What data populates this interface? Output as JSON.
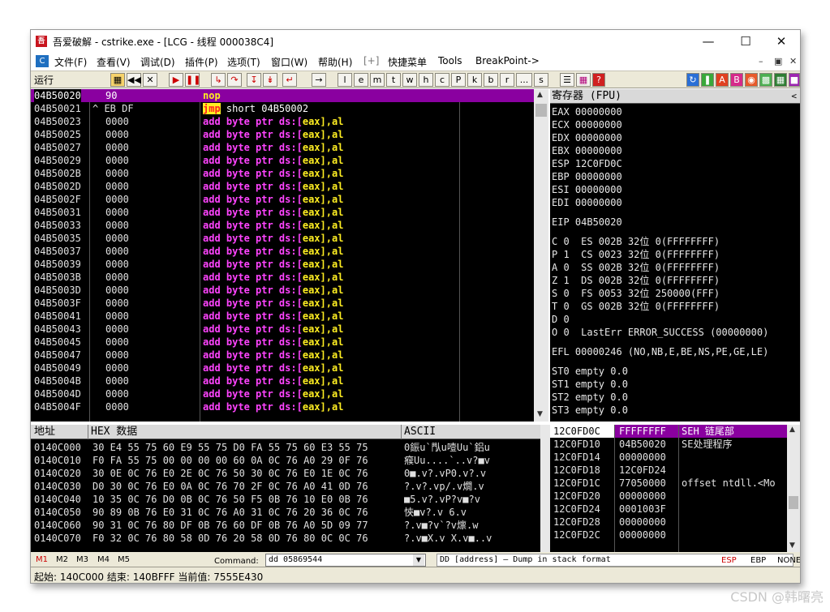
{
  "window": {
    "title": "吾爱破解 - cstrike.exe - [LCG - 线程 000038C4]",
    "app_icon": "吾爱"
  },
  "menu": {
    "items": [
      "文件(F)",
      "查看(V)",
      "调试(D)",
      "插件(P)",
      "选项(T)",
      "窗口(W)",
      "帮助(H)",
      "[+]",
      "快捷菜单",
      "Tools",
      "BreakPoint->"
    ]
  },
  "toolbar": {
    "status": "运行",
    "letters": [
      "l",
      "e",
      "m",
      "t",
      "w",
      "h",
      "c",
      "P",
      "k",
      "b",
      "r",
      "...",
      "s"
    ]
  },
  "disasm": {
    "rows": [
      {
        "addr": "04B50020",
        "hex": "90",
        "asm": "nop",
        "sel": true
      },
      {
        "addr": "04B50021",
        "hex": "^ EB DF",
        "asm": "jmp",
        "arg": " short 04B50002",
        "jmp": true
      },
      {
        "addr": "04B50023",
        "hex": "0000",
        "asm": "add"
      },
      {
        "addr": "04B50025",
        "hex": "0000",
        "asm": "add"
      },
      {
        "addr": "04B50027",
        "hex": "0000",
        "asm": "add"
      },
      {
        "addr": "04B50029",
        "hex": "0000",
        "asm": "add"
      },
      {
        "addr": "04B5002B",
        "hex": "0000",
        "asm": "add"
      },
      {
        "addr": "04B5002D",
        "hex": "0000",
        "asm": "add"
      },
      {
        "addr": "04B5002F",
        "hex": "0000",
        "asm": "add"
      },
      {
        "addr": "04B50031",
        "hex": "0000",
        "asm": "add"
      },
      {
        "addr": "04B50033",
        "hex": "0000",
        "asm": "add"
      },
      {
        "addr": "04B50035",
        "hex": "0000",
        "asm": "add"
      },
      {
        "addr": "04B50037",
        "hex": "0000",
        "asm": "add"
      },
      {
        "addr": "04B50039",
        "hex": "0000",
        "asm": "add"
      },
      {
        "addr": "04B5003B",
        "hex": "0000",
        "asm": "add"
      },
      {
        "addr": "04B5003D",
        "hex": "0000",
        "asm": "add"
      },
      {
        "addr": "04B5003F",
        "hex": "0000",
        "asm": "add"
      },
      {
        "addr": "04B50041",
        "hex": "0000",
        "asm": "add"
      },
      {
        "addr": "04B50043",
        "hex": "0000",
        "asm": "add"
      },
      {
        "addr": "04B50045",
        "hex": "0000",
        "asm": "add"
      },
      {
        "addr": "04B50047",
        "hex": "0000",
        "asm": "add"
      },
      {
        "addr": "04B50049",
        "hex": "0000",
        "asm": "add"
      },
      {
        "addr": "04B5004B",
        "hex": "0000",
        "asm": "add"
      },
      {
        "addr": "04B5004D",
        "hex": "0000",
        "asm": "add"
      },
      {
        "addr": "04B5004F",
        "hex": "0000",
        "asm": "add"
      }
    ],
    "add_operand": " byte ptr ds:[eax],al"
  },
  "registers": {
    "header": "寄存器 (FPU)",
    "lines": [
      "EAX 00000000",
      "ECX 00000000",
      "EDX 00000000",
      "EBX 00000000",
      "ESP 12C0FD0C",
      "EBP 00000000",
      "ESI 00000000",
      "EDI 00000000",
      "",
      "EIP 04B50020",
      "",
      "C 0  ES 002B 32位 0(FFFFFFFF)",
      "P 1  CS 0023 32位 0(FFFFFFFF)",
      "A 0  SS 002B 32位 0(FFFFFFFF)",
      "Z 1  DS 002B 32位 0(FFFFFFFF)",
      "S 0  FS 0053 32位 250000(FFF)",
      "T 0  GS 002B 32位 0(FFFFFFFF)",
      "D 0",
      "O 0  LastErr ERROR_SUCCESS (00000000)",
      "",
      "EFL 00000246 (NO,NB,E,BE,NS,PE,GE,LE)",
      "",
      "ST0 empty 0.0",
      "ST1 empty 0.0",
      "ST2 empty 0.0",
      "ST3 empty 0.0"
    ]
  },
  "dump": {
    "h_addr": "地址",
    "h_hex": "HEX 数据",
    "h_ascii": "ASCII",
    "rows": [
      {
        "addr": "0140C000",
        "hex": "30 E4 55 75 60 E9 55 75 D0 FA 55 75 60 E3 55 75",
        "ascii": "0鋠u`閄u噎Uu`鋁u"
      },
      {
        "addr": "0140C010",
        "hex": "F0 FA 55 75 00 00 00 00 60 0A 0C 76 A0 29 0F 76",
        "ascii": "瘊Uu....`..v?■v"
      },
      {
        "addr": "0140C020",
        "hex": "30 0E 0C 76 E0 2E 0C 76 50 30 0C 76 E0 1E 0C 76",
        "ascii": "0■.v?.vP0.v?.v"
      },
      {
        "addr": "0140C030",
        "hex": "D0 30 0C 76 E0 0A 0C 76 70 2F 0C 76 A0 41 0D 76",
        "ascii": "?.v?.vp/.v燗.v"
      },
      {
        "addr": "0140C040",
        "hex": "10 35 0C 76 D0 0B 0C 76 50 F5 0B 76 10 E0 0B 76",
        "ascii": "■5.v?.vP?v■?v"
      },
      {
        "addr": "0140C050",
        "hex": "90 89 0B 76 E0 31 0C 76 A0 31 0C 76 20 36 0C 76",
        "ascii": "悏■v?.v 6.v"
      },
      {
        "addr": "0140C060",
        "hex": "90 31 0C 76 80 DF 0B 76 60 DF 0B 76 A0 5D 09 77",
        "ascii": "?.v■?v`?v燷.w"
      },
      {
        "addr": "0140C070",
        "hex": "F0 32 0C 76 80 58 0D 76 20 58 0D 76 80 0C 0C 76",
        "ascii": "?.v■X.v X.v■..v"
      }
    ]
  },
  "stack": {
    "sel_addr": "12C0FD0C",
    "sel_val": "FFFFFFFF",
    "sel_comment": "SEH 链尾部",
    "rows": [
      {
        "addr": "12C0FD10",
        "val": "04B50020",
        "comment": "SE处理程序"
      },
      {
        "addr": "12C0FD14",
        "val": "00000000",
        "comment": ""
      },
      {
        "addr": "12C0FD18",
        "val": "12C0FD24",
        "comment": ""
      },
      {
        "addr": "12C0FD1C",
        "val": "77050000",
        "comment": "offset ntdll.<Mo"
      },
      {
        "addr": "12C0FD20",
        "val": "00000000",
        "comment": ""
      },
      {
        "addr": "12C0FD24",
        "val": "0001003F",
        "comment": ""
      },
      {
        "addr": "12C0FD28",
        "val": "00000000",
        "comment": ""
      },
      {
        "addr": "12C0FD2C",
        "val": "00000000",
        "comment": ""
      }
    ]
  },
  "command": {
    "marks": [
      "M1",
      "M2",
      "M3",
      "M4",
      "M5"
    ],
    "label": "Command:",
    "value": "dd 05869544",
    "hint": "DD [address] — Dump in stack format",
    "right": [
      "ESP",
      "EBP",
      "NONE"
    ]
  },
  "status": {
    "text": "起始: 140C000 结束: 140BFFF 当前值: 7555E430"
  },
  "watermark": "CSDN @韩曙亮"
}
